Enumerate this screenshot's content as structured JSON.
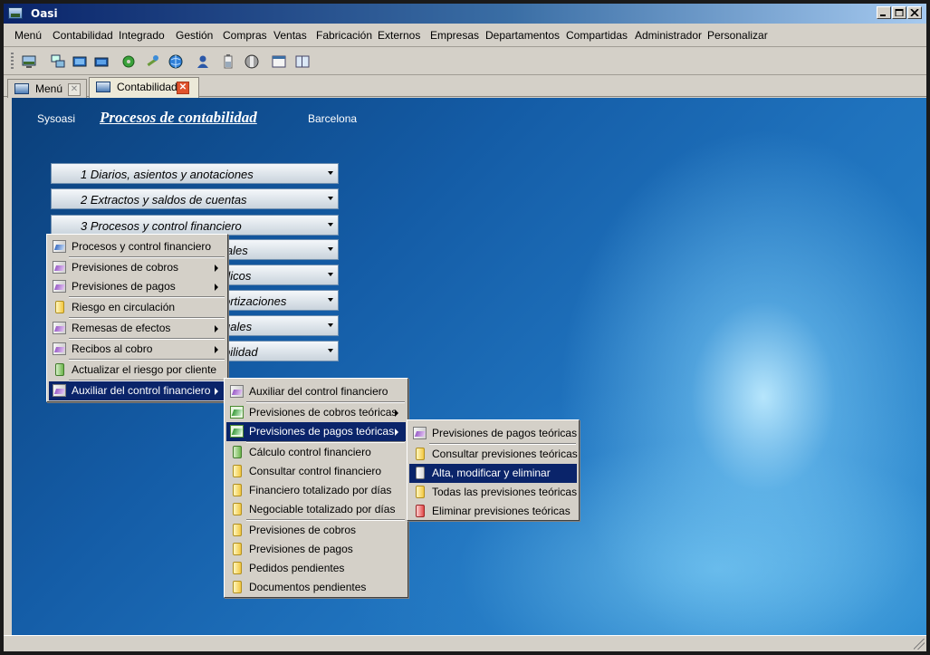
{
  "window": {
    "title": "Oasi"
  },
  "menubar": [
    "Menú",
    "Contabilidad",
    "Integrado",
    "Gestión",
    "Compras",
    "Ventas",
    "Fabricación",
    "Externos",
    "Empresas",
    "Departamentos",
    "Compartidas",
    "Administrador",
    "Personalizar"
  ],
  "toolbar": {
    "icons": [
      "desktop-icon",
      "network-icon",
      "monitor-icon",
      "monitor-alt-icon",
      "gear-green-icon",
      "tools-icon",
      "globe-icon",
      "user-icon",
      "battery-icon",
      "disk-icon",
      "window-icon",
      "window-split-icon"
    ]
  },
  "tabs": [
    {
      "label": "Menú",
      "active": false
    },
    {
      "label": "Contabilidad",
      "active": true
    }
  ],
  "header": {
    "left": "Sysoasi",
    "title": "Procesos de contabilidad",
    "right": "Barcelona"
  },
  "sections": [
    {
      "label": "1  Diarios, asientos y anotaciones"
    },
    {
      "label": "2  Extractos y saldos de cuentas"
    },
    {
      "label": "3  Procesos y control financiero"
    },
    {
      "label": "iales"
    },
    {
      "label": "dicos"
    },
    {
      "label": "ortizaciones"
    },
    {
      "label": "uales"
    },
    {
      "label": "bilidad"
    }
  ],
  "menu1": {
    "items": [
      {
        "label": "Procesos y control financiero",
        "icon": "blue",
        "sub": false,
        "highlight": false
      },
      {
        "label": "Previsiones de cobros",
        "icon": "purple",
        "sub": true,
        "highlight": false
      },
      {
        "label": "Previsiones de pagos",
        "icon": "purple",
        "sub": true,
        "highlight": false
      },
      {
        "label": "Riesgo en circulación",
        "icon": "yellow",
        "sub": false,
        "highlight": false
      },
      {
        "label": "Remesas de efectos",
        "icon": "purple",
        "sub": true,
        "highlight": false
      },
      {
        "label": "Recibos al cobro",
        "icon": "purple",
        "sub": true,
        "highlight": false
      },
      {
        "label": "Actualizar el riesgo por cliente",
        "icon": "green",
        "sub": false,
        "highlight": false
      },
      {
        "label": "Auxiliar del control financiero",
        "icon": "purple",
        "sub": true,
        "highlight": true
      }
    ]
  },
  "menu2": {
    "items": [
      {
        "label": "Auxiliar del control financiero",
        "icon": "purple",
        "sub": false,
        "highlight": false
      },
      {
        "label": "Previsiones de cobros teóricas",
        "icon": "green2",
        "sub": true,
        "highlight": false
      },
      {
        "label": "Previsiones de pagos teóricas",
        "icon": "green2",
        "sub": true,
        "highlight": true
      },
      {
        "label": "Cálculo control financiero",
        "icon": "green",
        "sub": false,
        "highlight": false
      },
      {
        "label": "Consultar control financiero",
        "icon": "yellow",
        "sub": false,
        "highlight": false
      },
      {
        "label": "Financiero totalizado por días",
        "icon": "yellow",
        "sub": false,
        "highlight": false
      },
      {
        "label": "Negociable totalizado por días",
        "icon": "yellow",
        "sub": false,
        "highlight": false
      },
      {
        "label": "Previsiones de cobros",
        "icon": "yellow",
        "sub": false,
        "highlight": false
      },
      {
        "label": "Previsiones de pagos",
        "icon": "yellow",
        "sub": false,
        "highlight": false
      },
      {
        "label": "Pedidos pendientes",
        "icon": "yellow",
        "sub": false,
        "highlight": false
      },
      {
        "label": "Documentos pendientes",
        "icon": "yellow",
        "sub": false,
        "highlight": false
      }
    ]
  },
  "menu3": {
    "items": [
      {
        "label": "Previsiones de pagos teóricas",
        "icon": "purple",
        "sub": false,
        "highlight": false
      },
      {
        "label": "Consultar previsiones teóricas",
        "icon": "yellow",
        "sub": false,
        "highlight": false
      },
      {
        "label": "Alta, modificar y eliminar",
        "icon": "white",
        "sub": false,
        "highlight": true
      },
      {
        "label": "Todas las previsiones teóricas",
        "icon": "yellow",
        "sub": false,
        "highlight": false
      },
      {
        "label": "Eliminar previsiones teóricas",
        "icon": "red",
        "sub": false,
        "highlight": false
      }
    ]
  },
  "colors": {
    "titlebar": "#0a246a",
    "highlight": "#0a246a",
    "face": "#d4d0c8",
    "tab_close_active": "#e0532c"
  }
}
